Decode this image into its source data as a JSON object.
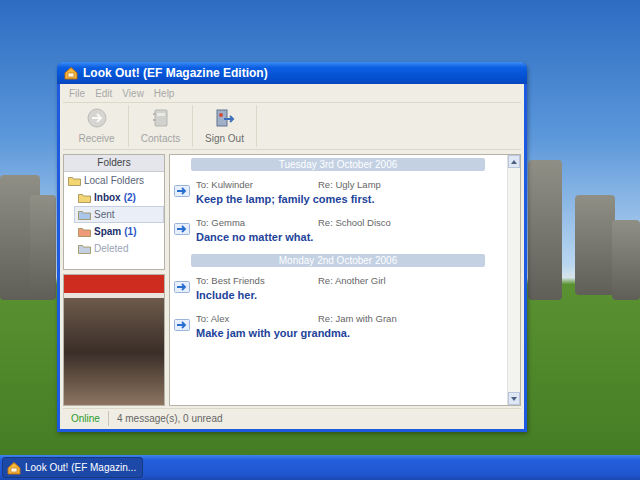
{
  "window": {
    "title": "Look Out! (EF Magazine Edition)"
  },
  "menu": [
    {
      "label": "File",
      "disabled": true
    },
    {
      "label": "Edit",
      "disabled": true
    },
    {
      "label": "View",
      "disabled": true
    },
    {
      "label": "Help",
      "disabled": true
    }
  ],
  "toolbar": [
    {
      "label": "Receive",
      "disabled": true
    },
    {
      "label": "Contacts",
      "disabled": true
    },
    {
      "label": "Sign Out",
      "disabled": false
    }
  ],
  "folders": {
    "title": "Folders",
    "root": "Local Folders",
    "items": [
      {
        "label": "Inbox",
        "count": "(2)",
        "unread": true,
        "selected": false,
        "disabled": false
      },
      {
        "label": "Sent",
        "unread": false,
        "selected": true,
        "disabled": false
      },
      {
        "label": "Spam",
        "count": "(1)",
        "unread": true,
        "selected": false,
        "disabled": false
      },
      {
        "label": "Deleted",
        "unread": false,
        "selected": false,
        "disabled": true
      }
    ]
  },
  "groups": [
    {
      "date": "Tuesday 3rd October 2006",
      "messages": [
        {
          "to": "To: Kulwinder",
          "re": "Re: Ugly Lamp",
          "body": "Keep the lamp; family comes first."
        },
        {
          "to": "To: Gemma",
          "re": "Re: School Disco",
          "body": "Dance no matter what."
        }
      ]
    },
    {
      "date": "Monday 2nd October 2006",
      "messages": [
        {
          "to": "To: Best Friends",
          "re": "Re: Another Girl",
          "body": "Include her."
        },
        {
          "to": "To: Alex",
          "re": "Re: Jam with Gran",
          "body": "Make jam with your grandma."
        }
      ]
    }
  ],
  "status_bar": {
    "connection": "Online",
    "summary": "4 message(s), 0 unread"
  },
  "taskbar": {
    "button": "Look Out! (EF Magazin..."
  }
}
